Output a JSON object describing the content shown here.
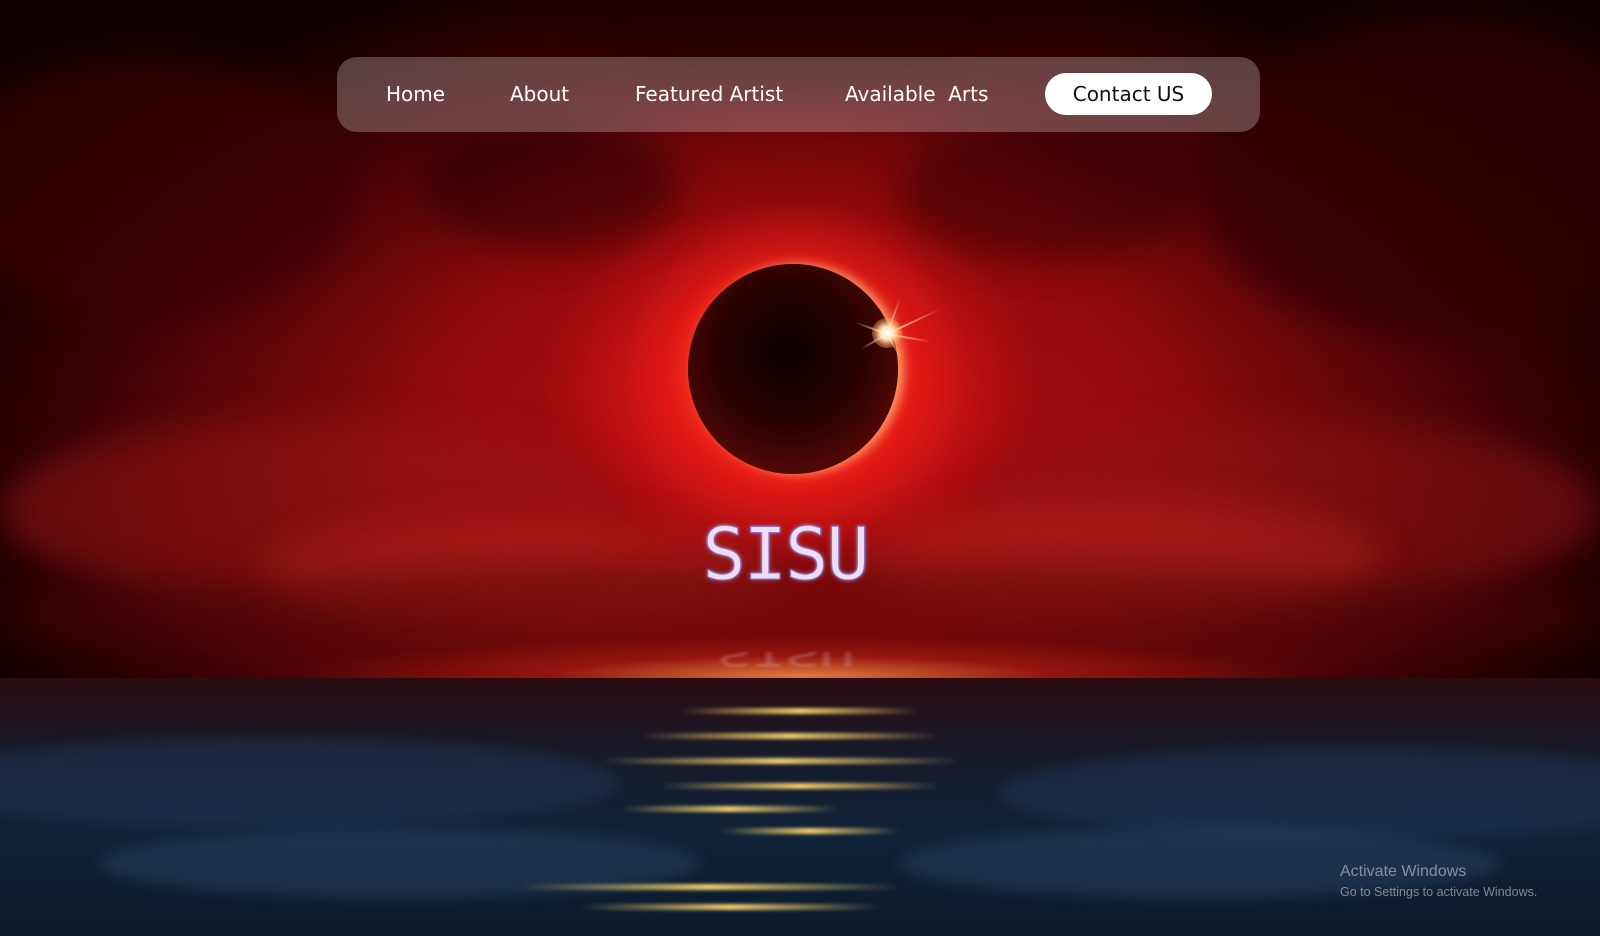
{
  "nav": {
    "items": [
      {
        "label": "Home"
      },
      {
        "label": "About"
      },
      {
        "label": "Featured Artist"
      },
      {
        "label": "Available  Arts"
      }
    ],
    "cta_label": "Contact US"
  },
  "hero": {
    "title": "SISU",
    "scene": "red-solar-eclipse-over-ocean"
  },
  "watermark": {
    "title": "Activate Windows",
    "subtitle": "Go to Settings to activate Windows."
  },
  "colors": {
    "sky_red": "#c8141a",
    "nav_glass": "#d2c8c8",
    "cta_bg": "#ffffff",
    "cta_text": "#111111",
    "nav_text": "#ffffff"
  }
}
